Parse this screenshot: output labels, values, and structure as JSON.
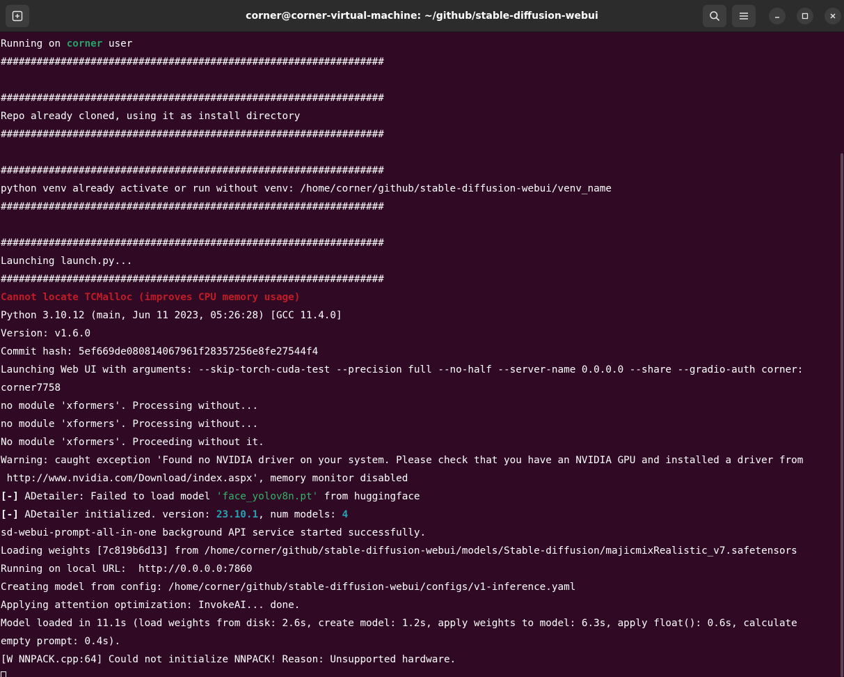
{
  "window": {
    "title": "corner@corner-virtual-machine: ~/github/stable-diffusion-webui",
    "icons": {
      "new_tab": "new-tab-icon",
      "search": "search-icon",
      "menu": "hamburger-menu-icon",
      "minimize": "minimize-icon",
      "maximize": "maximize-icon",
      "close": "close-icon"
    }
  },
  "colors": {
    "terminal_bg": "#300a24",
    "titlebar_bg": "#2c2c2c",
    "user_green": "#26a269",
    "error_red": "#c01c28",
    "number_teal": "#2aa1b3",
    "string_green": "#33b26b"
  },
  "terminal": {
    "l01_a": "Running on ",
    "l01_user": "corner",
    "l01_b": " user",
    "hashes": "################################################################",
    "l04": "Repo already cloned, using it as install directory",
    "l08": "python venv already activate or run without venv: /home/corner/github/stable-diffusion-webui/venv_name",
    "l12": "Launching launch.py...",
    "l14": "Cannot locate TCMalloc (improves CPU memory usage)",
    "l15": "Python 3.10.12 (main, Jun 11 2023, 05:26:28) [GCC 11.4.0]",
    "l16": "Version: v1.6.0",
    "l17": "Commit hash: 5ef669de080814067961f28357256e8fe27544f4",
    "l18": "Launching Web UI with arguments: --skip-torch-cuda-test --precision full --no-half --server-name 0.0.0.0 --share --gradio-auth corner:",
    "l19": "corner7758",
    "l20": "no module 'xformers'. Processing without...",
    "l21": "no module 'xformers'. Processing without...",
    "l22": "No module 'xformers'. Proceeding without it.",
    "l23": "Warning: caught exception 'Found no NVIDIA driver on your system. Please check that you have an NVIDIA GPU and installed a driver from",
    "l24": " http://www.nvidia.com/Download/index.aspx', memory monitor disabled",
    "l25_prefix": "[-]",
    "l25_a": " ADetailer: Failed to load model ",
    "l25_model": "'face_yolov8n.pt'",
    "l25_b": " from huggingface",
    "l26_prefix": "[-]",
    "l26_a": " ADetailer initialized. version: ",
    "l26_version": "23.10.1",
    "l26_b": ", num models: ",
    "l26_count": "4",
    "l27": "sd-webui-prompt-all-in-one background API service started successfully.",
    "l28": "Loading weights [7c819b6d13] from /home/corner/github/stable-diffusion-webui/models/Stable-diffusion/majicmixRealistic_v7.safetensors",
    "l29": "Running on local URL:  http://0.0.0.0:7860",
    "l30": "Creating model from config: /home/corner/github/stable-diffusion-webui/configs/v1-inference.yaml",
    "l31": "Applying attention optimization: InvokeAI... done.",
    "l32": "Model loaded in 11.1s (load weights from disk: 2.6s, create model: 1.2s, apply weights to model: 6.3s, apply float(): 0.6s, calculate",
    "l33": "empty prompt: 0.4s).",
    "l34": "[W NNPACK.cpp:64] Could not initialize NNPACK! Reason: Unsupported hardware."
  }
}
